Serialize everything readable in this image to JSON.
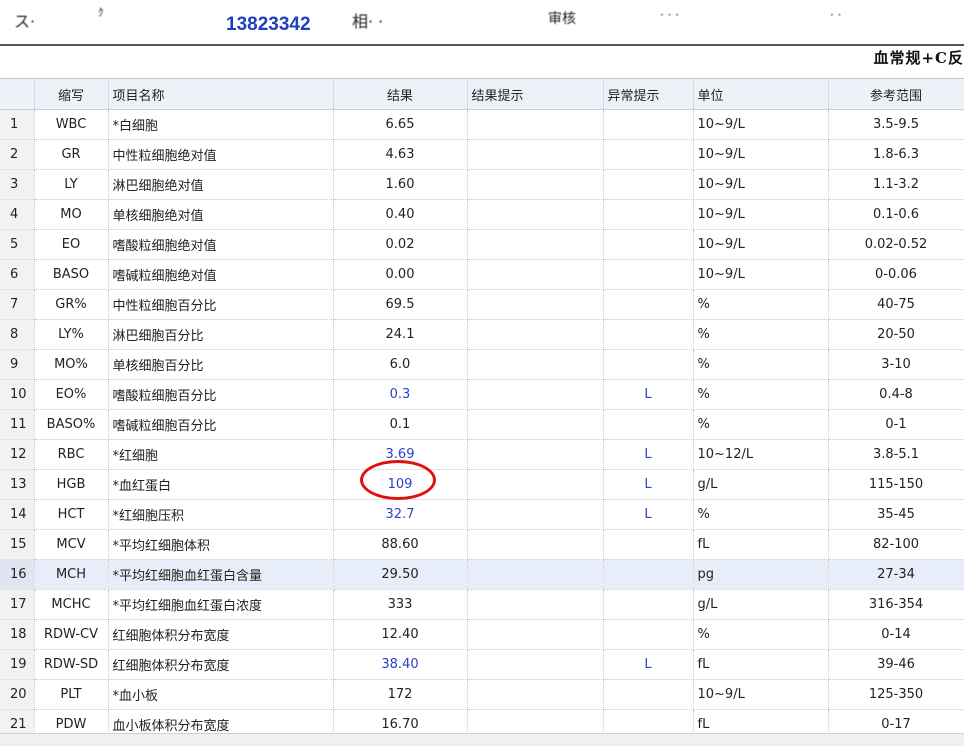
{
  "header": {
    "sample_id": "13823342",
    "report_title": "血常规+C反",
    "fragments": [
      "ス·",
      "ｸ",
      "相·  ·",
      "审核",
      "·  ·  ·",
      "·  ·"
    ]
  },
  "grid": {
    "columns": [
      "",
      "缩写",
      "项目名称",
      "结果",
      "结果提示",
      "异常提示",
      "单位",
      "参考范围"
    ],
    "rows": [
      {
        "no": "1",
        "abbr": "WBC",
        "name": "*白细胞",
        "result": "6.65",
        "hint": "",
        "flag": "",
        "unit": "10~9/L",
        "range": "3.5-9.5",
        "abnormal": false
      },
      {
        "no": "2",
        "abbr": "GR",
        "name": "中性粒细胞绝对值",
        "result": "4.63",
        "hint": "",
        "flag": "",
        "unit": "10~9/L",
        "range": "1.8-6.3",
        "abnormal": false
      },
      {
        "no": "3",
        "abbr": "LY",
        "name": "淋巴细胞绝对值",
        "result": "1.60",
        "hint": "",
        "flag": "",
        "unit": "10~9/L",
        "range": "1.1-3.2",
        "abnormal": false
      },
      {
        "no": "4",
        "abbr": "MO",
        "name": "单核细胞绝对值",
        "result": "0.40",
        "hint": "",
        "flag": "",
        "unit": "10~9/L",
        "range": "0.1-0.6",
        "abnormal": false
      },
      {
        "no": "5",
        "abbr": "EO",
        "name": "嗜酸粒细胞绝对值",
        "result": "0.02",
        "hint": "",
        "flag": "",
        "unit": "10~9/L",
        "range": "0.02-0.52",
        "abnormal": false
      },
      {
        "no": "6",
        "abbr": "BASO",
        "name": "嗜碱粒细胞绝对值",
        "result": "0.00",
        "hint": "",
        "flag": "",
        "unit": "10~9/L",
        "range": "0-0.06",
        "abnormal": false
      },
      {
        "no": "7",
        "abbr": "GR%",
        "name": "中性粒细胞百分比",
        "result": "69.5",
        "hint": "",
        "flag": "",
        "unit": "%",
        "range": "40-75",
        "abnormal": false
      },
      {
        "no": "8",
        "abbr": "LY%",
        "name": "淋巴细胞百分比",
        "result": "24.1",
        "hint": "",
        "flag": "",
        "unit": "%",
        "range": "20-50",
        "abnormal": false
      },
      {
        "no": "9",
        "abbr": "MO%",
        "name": "单核细胞百分比",
        "result": "6.0",
        "hint": "",
        "flag": "",
        "unit": "%",
        "range": "3-10",
        "abnormal": false
      },
      {
        "no": "10",
        "abbr": "EO%",
        "name": "嗜酸粒细胞百分比",
        "result": "0.3",
        "hint": "",
        "flag": "L",
        "unit": "%",
        "range": "0.4-8",
        "abnormal": true
      },
      {
        "no": "11",
        "abbr": "BASO%",
        "name": "嗜碱粒细胞百分比",
        "result": "0.1",
        "hint": "",
        "flag": "",
        "unit": "%",
        "range": "0-1",
        "abnormal": false
      },
      {
        "no": "12",
        "abbr": "RBC",
        "name": "*红细胞",
        "result": "3.69",
        "hint": "",
        "flag": "L",
        "unit": "10~12/L",
        "range": "3.8-5.1",
        "abnormal": true
      },
      {
        "no": "13",
        "abbr": "HGB",
        "name": "*血红蛋白",
        "result": "109",
        "hint": "",
        "flag": "L",
        "unit": "g/L",
        "range": "115-150",
        "abnormal": true
      },
      {
        "no": "14",
        "abbr": "HCT",
        "name": "*红细胞压积",
        "result": "32.7",
        "hint": "",
        "flag": "L",
        "unit": "%",
        "range": "35-45",
        "abnormal": true
      },
      {
        "no": "15",
        "abbr": "MCV",
        "name": "*平均红细胞体积",
        "result": "88.60",
        "hint": "",
        "flag": "",
        "unit": "fL",
        "range": "82-100",
        "abnormal": false
      },
      {
        "no": "16",
        "abbr": "MCH",
        "name": "*平均红细胞血红蛋白含量",
        "result": "29.50",
        "hint": "",
        "flag": "",
        "unit": "pg",
        "range": "27-34",
        "abnormal": false,
        "selected": true
      },
      {
        "no": "17",
        "abbr": "MCHC",
        "name": "*平均红细胞血红蛋白浓度",
        "result": "333",
        "hint": "",
        "flag": "",
        "unit": "g/L",
        "range": "316-354",
        "abnormal": false
      },
      {
        "no": "18",
        "abbr": "RDW-CV",
        "name": "红细胞体积分布宽度",
        "result": "12.40",
        "hint": "",
        "flag": "",
        "unit": "%",
        "range": "0-14",
        "abnormal": false
      },
      {
        "no": "19",
        "abbr": "RDW-SD",
        "name": "红细胞体积分布宽度",
        "result": "38.40",
        "hint": "",
        "flag": "L",
        "unit": "fL",
        "range": "39-46",
        "abnormal": true
      },
      {
        "no": "20",
        "abbr": "PLT",
        "name": "*血小板",
        "result": "172",
        "hint": "",
        "flag": "",
        "unit": "10~9/L",
        "range": "125-350",
        "abnormal": false
      },
      {
        "no": "21",
        "abbr": "PDW",
        "name": "血小板体积分布宽度",
        "result": "16.70",
        "hint": "",
        "flag": "",
        "unit": "fL",
        "range": "0-17",
        "abnormal": false
      }
    ]
  },
  "colors": {
    "abnormal_text": "#2b3fd0",
    "highlight_ring": "#e01010",
    "selected_row": "#e8eef9"
  }
}
